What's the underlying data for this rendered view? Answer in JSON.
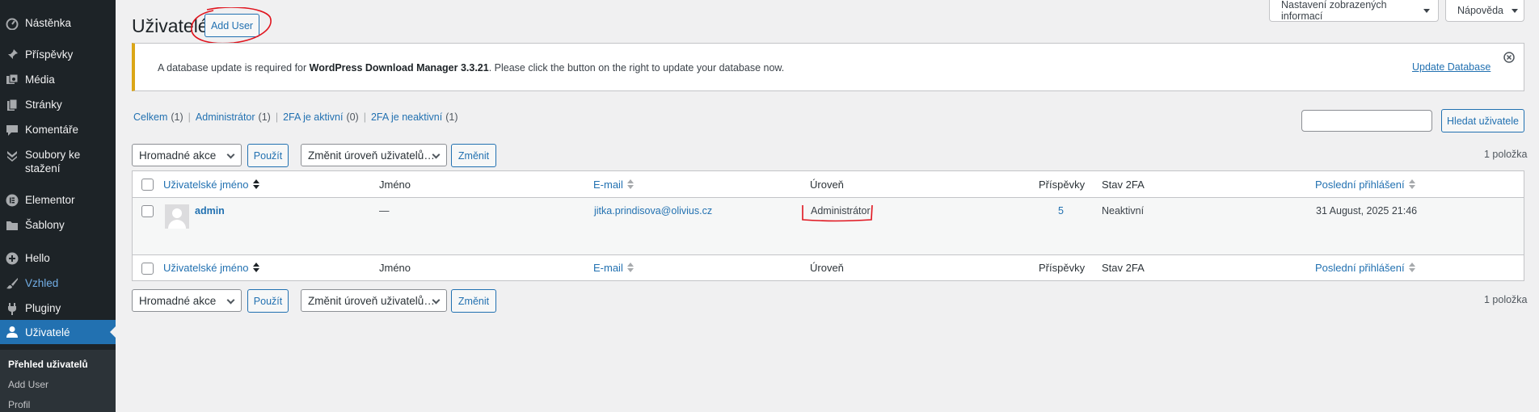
{
  "sidebar": {
    "items": [
      {
        "label": "Nástěnka",
        "icon": "dashboard-icon"
      },
      {
        "label": "Příspěvky",
        "icon": "pin-icon"
      },
      {
        "label": "Média",
        "icon": "media-icon"
      },
      {
        "label": "Stránky",
        "icon": "pages-icon"
      },
      {
        "label": "Komentáře",
        "icon": "comment-icon"
      },
      {
        "label": "Soubory ke stažení",
        "icon": "download-icon"
      },
      {
        "label": "Elementor",
        "icon": "elementor-icon"
      },
      {
        "label": "Šablony",
        "icon": "folder-icon"
      },
      {
        "label": "Hello",
        "icon": "plus-circle-icon"
      },
      {
        "label": "Vzhled",
        "icon": "brush-icon"
      },
      {
        "label": "Pluginy",
        "icon": "plug-icon"
      },
      {
        "label": "Uživatelé",
        "icon": "user-icon"
      }
    ],
    "submenu": [
      "Přehled uživatelů",
      "Add User",
      "Profil"
    ]
  },
  "screen_meta": {
    "screen_options": "Nastavení zobrazených informací",
    "help": "Nápověda"
  },
  "page": {
    "title": "Uživatelé",
    "add_user": "Add User"
  },
  "notice": {
    "text_before": "A database update is required for ",
    "plugin": "WordPress Download Manager 3.3.21",
    "text_after": ". Please click the button on the right to update your database now.",
    "link": "Update Database"
  },
  "views": [
    {
      "label": "Celkem",
      "count": "(1)"
    },
    {
      "label": "Administrátor",
      "count": "(1)"
    },
    {
      "label": "2FA je aktivní",
      "count": "(0)"
    },
    {
      "label": "2FA je neaktivní",
      "count": "(1)"
    }
  ],
  "search": {
    "button": "Hledat uživatele",
    "value": ""
  },
  "tablenav": {
    "bulk_action": "Hromadné akce",
    "apply": "Použít",
    "change_role": "Změnit úroveň uživatelů…",
    "change": "Změnit",
    "count": "1 položka"
  },
  "table": {
    "columns": {
      "username": "Uživatelské jméno",
      "name": "Jméno",
      "email": "E-mail",
      "role": "Úroveň",
      "posts": "Příspěvky",
      "twofa": "Stav 2FA",
      "last_login": "Poslední přihlášení"
    },
    "rows": [
      {
        "username": "admin",
        "name": "—",
        "email": "jitka.prindisova@olivius.cz",
        "role": "Administrátor",
        "posts": "5",
        "twofa": "Neaktivní",
        "last_login": "31 August, 2025 21:46"
      }
    ]
  },
  "colors": {
    "sidebar_bg": "#1d2327",
    "accent": "#2271b1",
    "notice_warning": "#dba617",
    "annotation": "#e0141e"
  }
}
